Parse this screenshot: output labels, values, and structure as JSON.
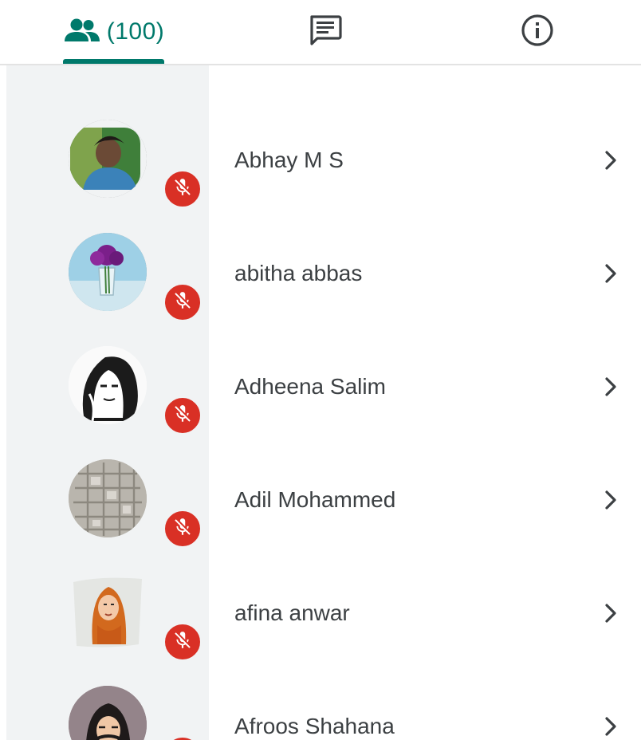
{
  "tabs": {
    "people": {
      "icon": "people-icon",
      "count": "(100)",
      "selected": true
    },
    "chat": {
      "icon": "chat-icon"
    },
    "info": {
      "icon": "info-icon"
    }
  },
  "colors": {
    "accent": "#00796b",
    "muted_badge": "#d93025",
    "avatar_column_bg": "#f1f3f4",
    "text": "#3c4043"
  },
  "participants": [
    {
      "name": "",
      "muted": true,
      "partial": true
    },
    {
      "name": "Abhay M S",
      "muted": true
    },
    {
      "name": "abitha abbas",
      "muted": true
    },
    {
      "name": "Adheena Salim",
      "muted": true
    },
    {
      "name": "Adil Mohammed",
      "muted": true
    },
    {
      "name": "afina anwar",
      "muted": true
    },
    {
      "name": "Afroos Shahana",
      "muted": true
    }
  ],
  "icons": {
    "muted": "mic-off-icon",
    "open_details": "chevron-right-icon"
  }
}
